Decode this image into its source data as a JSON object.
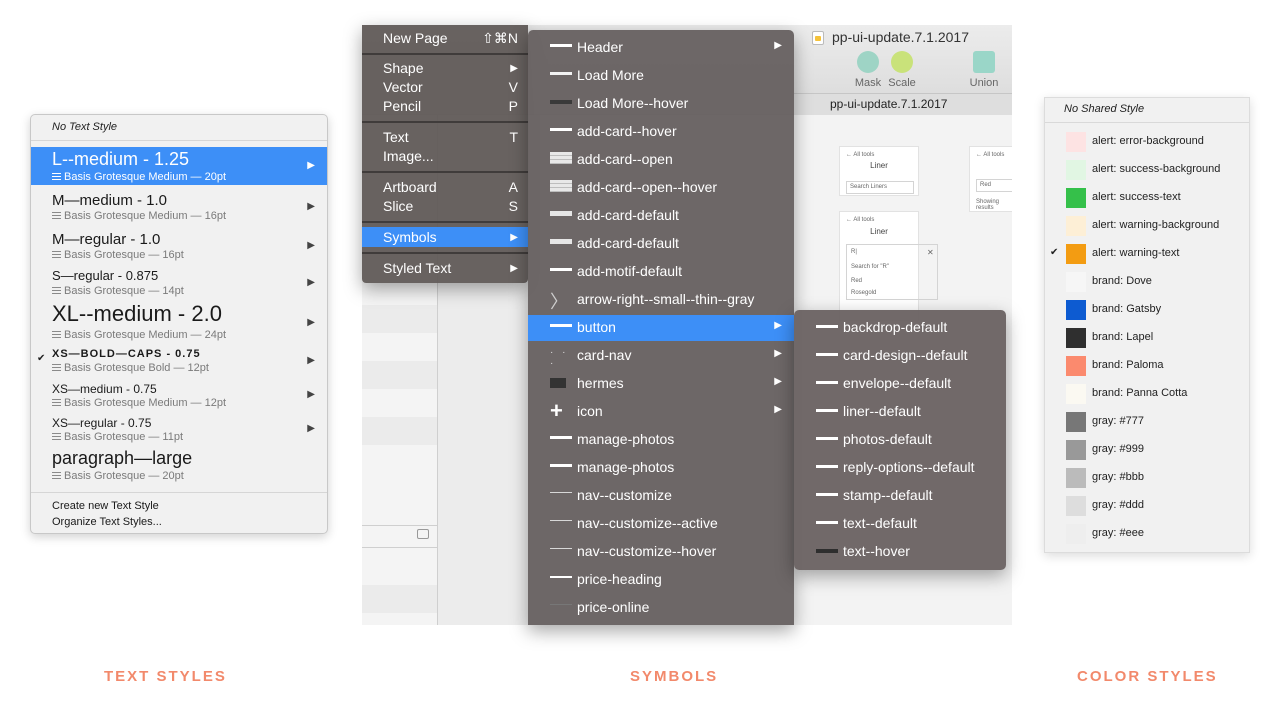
{
  "text_styles": {
    "none_label": "No Text Style",
    "items": [
      {
        "name": "L--medium - 1.25",
        "sub": "Basis Grotesque Medium — 20pt",
        "selected": true,
        "checked": false
      },
      {
        "name": "M—medium - 1.0",
        "sub": "Basis Grotesque Medium — 16pt",
        "selected": false,
        "checked": false
      },
      {
        "name": "M—regular - 1.0",
        "sub": "Basis Grotesque — 16pt",
        "selected": false,
        "checked": false
      },
      {
        "name": "S—regular - 0.875",
        "sub": "Basis Grotesque — 14pt",
        "selected": false,
        "checked": false
      },
      {
        "name": "XL--medium - 2.0",
        "sub": "Basis Grotesque Medium — 24pt",
        "selected": false,
        "checked": false
      },
      {
        "name": "XS—BOLD—CAPS - 0.75",
        "sub": "Basis Grotesque Bold — 12pt",
        "selected": false,
        "checked": true
      },
      {
        "name": "XS—medium - 0.75",
        "sub": "Basis Grotesque Medium — 12pt",
        "selected": false,
        "checked": false
      },
      {
        "name": "XS—regular - 0.75",
        "sub": "Basis Grotesque — 11pt",
        "selected": false,
        "checked": false
      },
      {
        "name": "paragraph—large",
        "sub": "Basis Grotesque — 20pt",
        "selected": false,
        "checked": false
      }
    ],
    "footer": {
      "create": "Create new Text Style",
      "organize": "Organize Text Styles..."
    }
  },
  "window": {
    "title": "pp-ui-update.7.1.2017",
    "tab_title": "pp-ui-update.7.1.2017",
    "tools": [
      {
        "label": "Mask",
        "color": "#9ed4c5"
      },
      {
        "label": "Scale",
        "color": "#c9e27a"
      },
      {
        "label": "Union",
        "color": "#9ad6c8"
      }
    ],
    "artboards": {
      "all_tools": "All tools",
      "liner": "Liner",
      "search_placeholder": "Search Liners",
      "search_for": "Search for \"R\"",
      "result1": "Red",
      "result2": "Rosegold",
      "showing": "Showing results",
      "red": "Red"
    }
  },
  "insert_menu": {
    "items": [
      {
        "label": "New Page",
        "shortcut": "⇧⌘N"
      },
      {
        "label": "Shape",
        "shortcut": "▶"
      },
      {
        "label": "Vector",
        "shortcut": "V"
      },
      {
        "label": "Pencil",
        "shortcut": "P"
      },
      {
        "label": "Text",
        "shortcut": "T"
      },
      {
        "label": "Image...",
        "shortcut": ""
      },
      {
        "label": "Artboard",
        "shortcut": "A"
      },
      {
        "label": "Slice",
        "shortcut": "S"
      },
      {
        "label": "Symbols",
        "shortcut": "▶"
      },
      {
        "label": "Styled Text",
        "shortcut": "▶"
      }
    ]
  },
  "symbols_menu": {
    "items": [
      {
        "label": "Header",
        "submenu": true
      },
      {
        "label": "Load More",
        "submenu": false
      },
      {
        "label": "Load More--hover",
        "submenu": false
      },
      {
        "label": "add-card--hover",
        "submenu": false
      },
      {
        "label": "add-card--open",
        "submenu": false
      },
      {
        "label": "add-card--open--hover",
        "submenu": false
      },
      {
        "label": "add-card-default",
        "submenu": false
      },
      {
        "label": "add-card-default",
        "submenu": false
      },
      {
        "label": "add-motif-default",
        "submenu": false
      },
      {
        "label": "arrow-right--small--thin--gray",
        "submenu": false
      },
      {
        "label": "button",
        "submenu": true
      },
      {
        "label": "card-nav",
        "submenu": true
      },
      {
        "label": "hermes",
        "submenu": true
      },
      {
        "label": "icon",
        "submenu": true
      },
      {
        "label": "manage-photos",
        "submenu": false
      },
      {
        "label": "manage-photos",
        "submenu": false
      },
      {
        "label": "nav--customize",
        "submenu": false
      },
      {
        "label": "nav--customize--active",
        "submenu": false
      },
      {
        "label": "nav--customize--hover",
        "submenu": false
      },
      {
        "label": "price-heading",
        "submenu": false
      },
      {
        "label": "price-online",
        "submenu": false
      }
    ]
  },
  "button_menu": {
    "items": [
      "backdrop-default",
      "card-design--default",
      "envelope--default",
      "liner--default",
      "photos-default",
      "reply-options--default",
      "stamp--default",
      "text--default",
      "text--hover"
    ]
  },
  "color_styles": {
    "none_label": "No Shared Style",
    "items": [
      {
        "name": "alert: error-background",
        "color": "#fde3e3",
        "checked": false
      },
      {
        "name": "alert: success-background",
        "color": "#e1f6e3",
        "checked": false
      },
      {
        "name": "alert: success-text",
        "color": "#35c04a",
        "checked": false
      },
      {
        "name": "alert: warning-background",
        "color": "#fdefd6",
        "checked": false
      },
      {
        "name": "alert: warning-text",
        "color": "#f39c12",
        "checked": true
      },
      {
        "name": "brand: Dove",
        "color": "#f6f6f6",
        "checked": false
      },
      {
        "name": "brand: Gatsby",
        "color": "#0d5bd1",
        "checked": false
      },
      {
        "name": "brand: Lapel",
        "color": "#2f2f2f",
        "checked": false
      },
      {
        "name": "brand: Paloma",
        "color": "#fb8a6e",
        "checked": false
      },
      {
        "name": "brand: Panna Cotta",
        "color": "#fbf9f2",
        "checked": false
      },
      {
        "name": "gray: #777",
        "color": "#777777",
        "checked": false
      },
      {
        "name": "gray: #999",
        "color": "#999999",
        "checked": false
      },
      {
        "name": "gray: #bbb",
        "color": "#bbbbbb",
        "checked": false
      },
      {
        "name": "gray: #ddd",
        "color": "#dddddd",
        "checked": false
      },
      {
        "name": "gray: #eee",
        "color": "#eeeeee",
        "checked": false
      }
    ]
  },
  "captions": {
    "text_styles": "TEXT STYLES",
    "symbols": "SYMBOLS",
    "color_styles": "COLOR STYLES"
  },
  "accent_color": "#3d8ff7",
  "caption_color": "#f2896b"
}
